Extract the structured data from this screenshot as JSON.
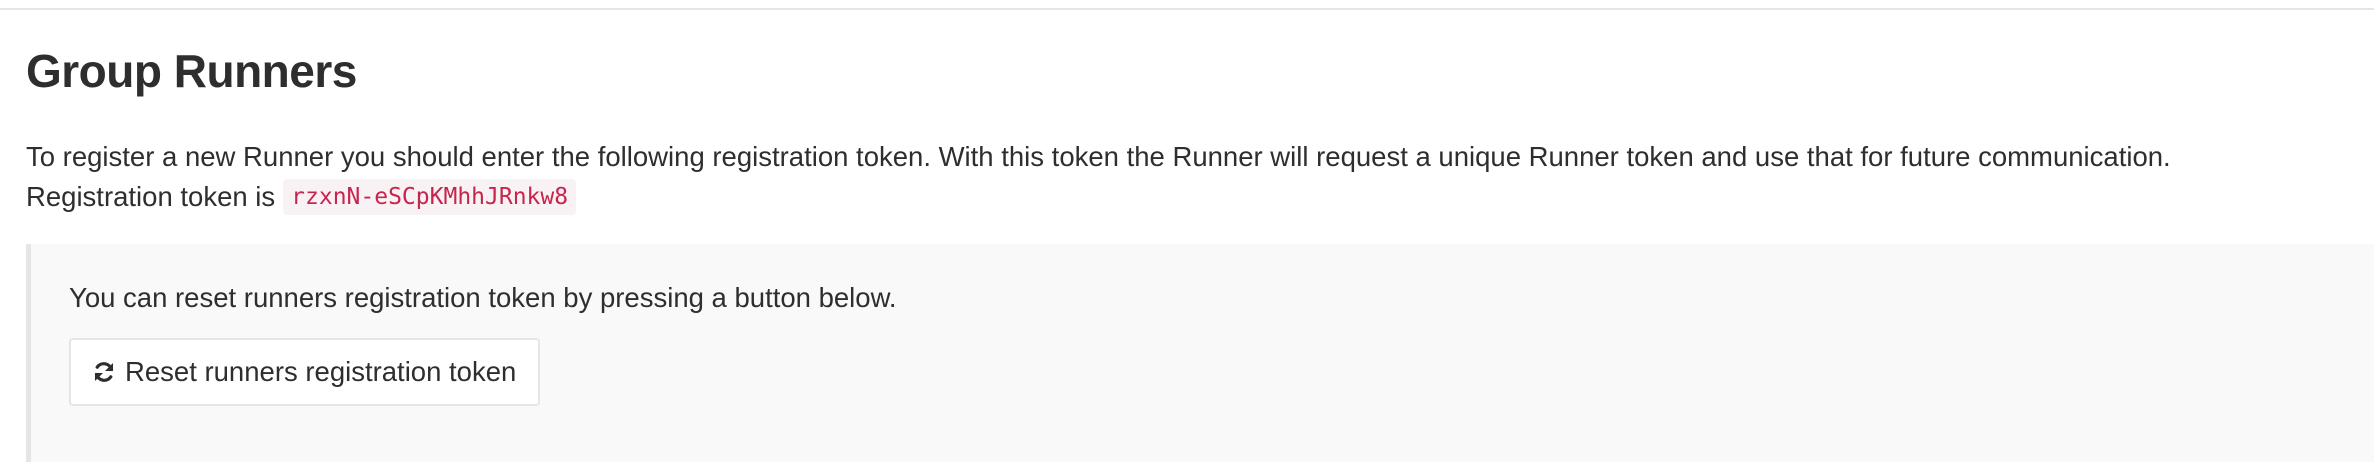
{
  "page": {
    "title": "Group Runners"
  },
  "intro": {
    "text": "To register a new Runner you should enter the following registration token. With this token the Runner will request a unique Runner token and use that for future communication.",
    "token_label": "Registration token is",
    "token_value": "rzxnN-eSCpKMhhJRnkw8"
  },
  "reset_panel": {
    "description": "You can reset runners registration token by pressing a button below.",
    "button_label": "Reset runners registration token",
    "button_icon": "refresh-icon"
  },
  "colors": {
    "text": "#2e2e2e",
    "token_text": "#c7254e",
    "token_bg": "#f9f2f4",
    "panel_bg": "#f9f9f9",
    "border": "#e5e5e5"
  }
}
